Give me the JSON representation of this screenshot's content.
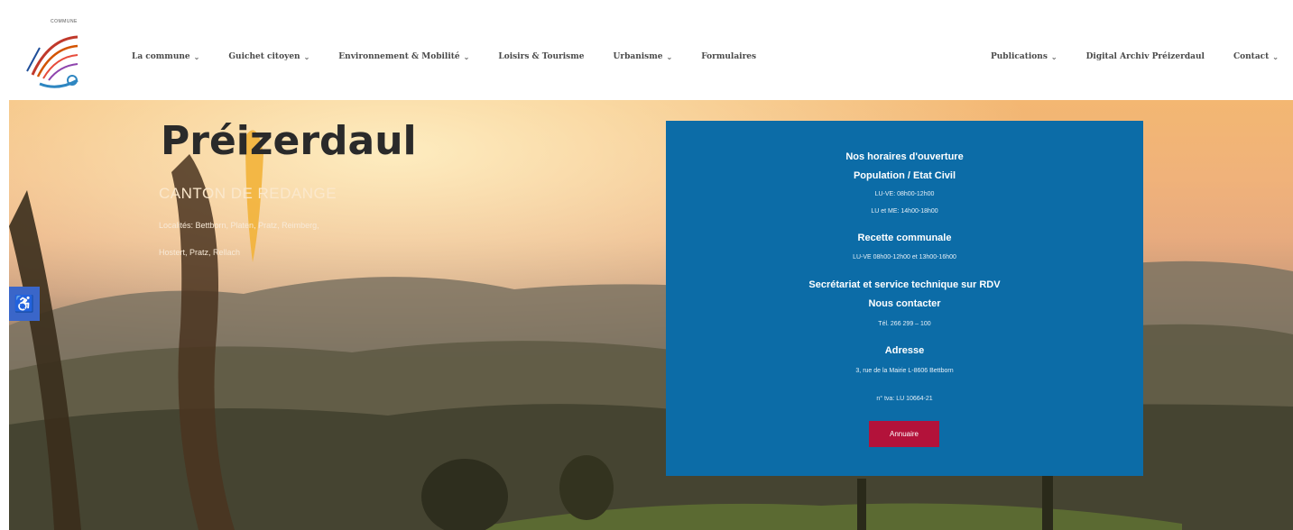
{
  "header": {
    "logo_label": "COMMUNE",
    "nav_left": [
      {
        "label": "La commune",
        "has_menu": true
      },
      {
        "label": "Guichet citoyen",
        "has_menu": true
      },
      {
        "label": "Environnement & Mobilité",
        "has_menu": true
      },
      {
        "label": "Loisirs & Tourisme",
        "has_menu": false
      },
      {
        "label": "Urbanisme",
        "has_menu": true
      },
      {
        "label": "Formulaires",
        "has_menu": false
      }
    ],
    "nav_right": [
      {
        "label": "Publications",
        "has_menu": true
      },
      {
        "label": "Digital Archiv Préizerdaul",
        "has_menu": false
      },
      {
        "label": "Contact",
        "has_menu": true
      }
    ],
    "chevron": "⌄"
  },
  "hero": {
    "title": "Préizerdaul",
    "subtitle": "CANTON DE REDANGE",
    "localities_line1": "Localités: Bettborn, Platen, Pratz, Reimberg,",
    "localities_line2": "Hostert, Pratz, Rellach"
  },
  "info_box": {
    "heading": "Nos horaires d'ouverture",
    "pop_title": "Population / Etat Civil",
    "pop_line1": "LU-VE: 08h00-12h00",
    "pop_line2": "LU et ME: 14h00-18h00",
    "recette_title": "Recette communale",
    "recette_line": "LU-VE 08h00-12h00 et 13h00-16h00",
    "secretariat_title": "Secrétariat et service technique sur RDV",
    "contact_title": "Nous contacter",
    "tel": "Tél. 266 299 – 100",
    "address_title": "Adresse",
    "address": "3, rue de la Mairie L-8606 Bettborn",
    "tva": "n° tva: LU 10664-21",
    "button": "Annuaire"
  },
  "accessibility": {
    "icon": "wheelchair-icon",
    "glyph": "♿"
  },
  "colors": {
    "info_bg": "#0c6ca7",
    "button_bg": "#b3123a",
    "access_bg": "#3a66c9"
  }
}
